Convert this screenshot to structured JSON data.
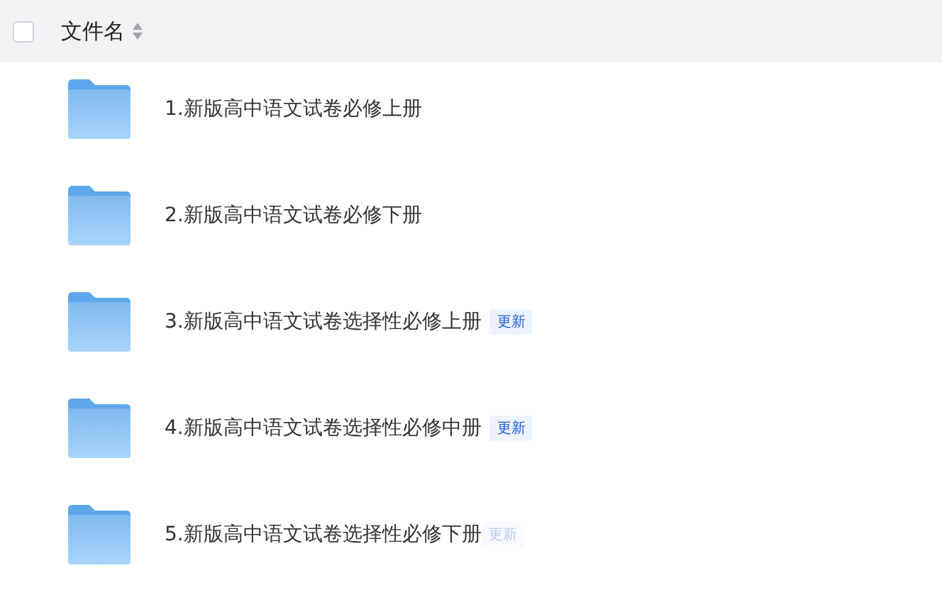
{
  "header": {
    "checked": false,
    "column": "文件名"
  },
  "files": [
    {
      "name": "1.新版高中语文试卷必修上册"
    },
    {
      "name": "2.新版高中语文试卷必修下册"
    },
    {
      "name": "3.新版高中语文试卷选择性必修上册",
      "badge": {
        "text": "更新",
        "faded": false
      }
    },
    {
      "name": "4.新版高中语文试卷选择性必修中册",
      "badge": {
        "text": "更新",
        "faded": false
      }
    },
    {
      "name": "5.新版高中语文试卷选择性必修下册",
      "badge": {
        "text": "更新",
        "faded": true
      }
    }
  ]
}
